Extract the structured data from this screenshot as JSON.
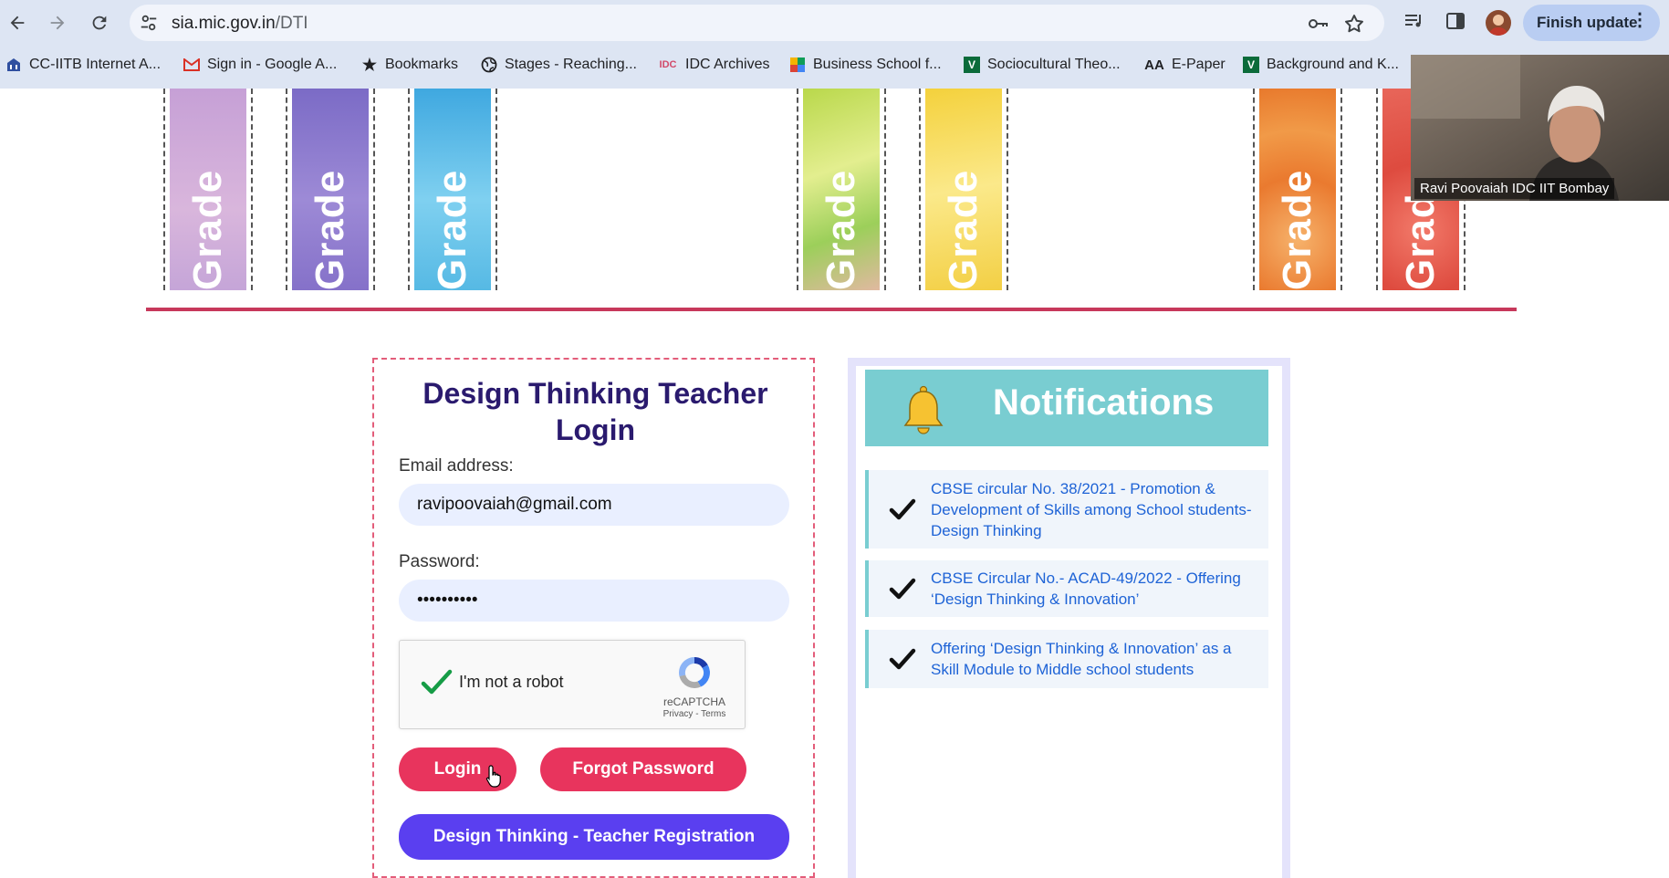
{
  "browser": {
    "url_host": "sia.mic.gov.in",
    "url_path": "/DTI",
    "finish_update_label": "Finish update",
    "icons": [
      "back-icon",
      "forward-icon",
      "reload-icon",
      "site-settings-icon",
      "password-key-icon",
      "bookmark-star-icon",
      "media-control-icon",
      "side-panel-icon"
    ]
  },
  "bookmarks": [
    {
      "label": "CC-IITB Internet A...",
      "icon": "building-icon"
    },
    {
      "label": "Sign in - Google A...",
      "icon": "gmail-icon"
    },
    {
      "label": "Bookmarks",
      "icon": "star-icon"
    },
    {
      "label": "Stages - Reaching...",
      "icon": "globe-icon"
    },
    {
      "label": "IDC Archives",
      "icon": "idc-icon"
    },
    {
      "label": "Business School f...",
      "icon": "puzzle-icon"
    },
    {
      "label": "Sociocultural Theo...",
      "icon": "v-icon"
    },
    {
      "label": "E-Paper",
      "icon": "aa-icon"
    },
    {
      "label": "Background and K...",
      "icon": "v-icon"
    }
  ],
  "grade_strips": [
    {
      "label": "Grade",
      "color": "#c9a3d4"
    },
    {
      "label": "Grade",
      "color": "#8573c9"
    },
    {
      "label": "Grade",
      "color": "#55b8e3"
    },
    {
      "label": "Grade",
      "color": "#c6de5a"
    },
    {
      "label": "Grade",
      "color": "#f6dc55"
    },
    {
      "label": "Grade",
      "color": "#ef8c3c"
    },
    {
      "label": "Grade",
      "color": "#e65a4c"
    }
  ],
  "login": {
    "title_line1": "Design Thinking Teacher",
    "title_line2": "Login",
    "email_label": "Email address:",
    "email_value": "ravipoovaiah@gmail.com",
    "password_label": "Password:",
    "password_value": "••••••••••",
    "recaptcha_text": "I'm not a robot",
    "recaptcha_brand": "reCAPTCHA",
    "recaptcha_links": "Privacy - Terms",
    "login_button": "Login",
    "forgot_button": "Forgot Password",
    "register_button": "Design Thinking - Teacher Registration"
  },
  "notifications": {
    "title": "Notifications",
    "items": [
      {
        "text": "CBSE circular No. 38/2021 - Promotion & Development of Skills among School students- Design Thinking"
      },
      {
        "text": "CBSE Circular No.- ACAD-49/2022 - Offering ‘Design Thinking & Innovation’"
      },
      {
        "text": "Offering ‘Design Thinking & Innovation’ as a Skill Module to Middle school students"
      }
    ]
  },
  "video": {
    "participant_name": "Ravi Poovaiah IDC IIT Bombay"
  },
  "colors": {
    "accent_pink": "#e8345d",
    "accent_purple": "#5a3ff0",
    "notif_teal": "#79cdd1",
    "link_blue": "#1e63d6",
    "title_navy": "#2a1a6e"
  }
}
